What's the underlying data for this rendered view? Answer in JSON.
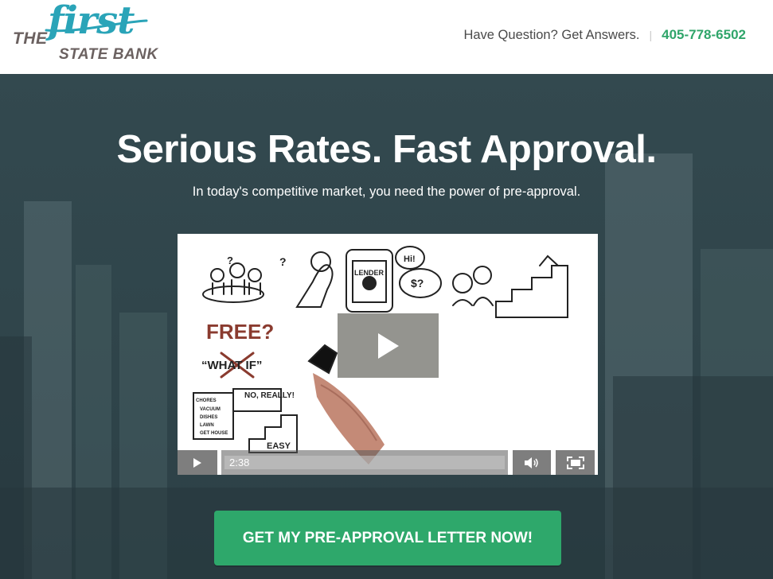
{
  "brand": {
    "logo_the": "THE",
    "logo_first": "first",
    "logo_state_bank": "STATE BANK"
  },
  "header": {
    "question": "Have Question? Get Answers.",
    "separator": "|",
    "phone": "405-778-6502"
  },
  "hero": {
    "headline": "Serious Rates. Fast Approval.",
    "subhead": "In today's competitive market, you need the power of pre-approval."
  },
  "video": {
    "current_time": "2:38",
    "sketch_labels": {
      "lender": "LENDER",
      "hi": "Hi!",
      "dollar": "$?",
      "free": "FREE?",
      "what_if": "“WHAT IF”",
      "no_really": "NO, REALLY!",
      "chores": "CHORES",
      "vacuum": "VACUUM",
      "dishes": "DISHES",
      "lawn": "LAWN",
      "get_house": "GET HOUSE",
      "easy": "EASY",
      "q1": "?",
      "q2": "?"
    }
  },
  "cta": {
    "label": "GET MY PRE-APPROVAL LETTER NOW!"
  },
  "colors": {
    "brand_teal": "#2aa4b8",
    "brand_gray": "#6b6160",
    "accent_green": "#2fa56a",
    "hero_bg": "#33494f"
  },
  "icons": [
    "play-icon",
    "volume-icon",
    "fullscreen-icon",
    "large-play-icon"
  ]
}
